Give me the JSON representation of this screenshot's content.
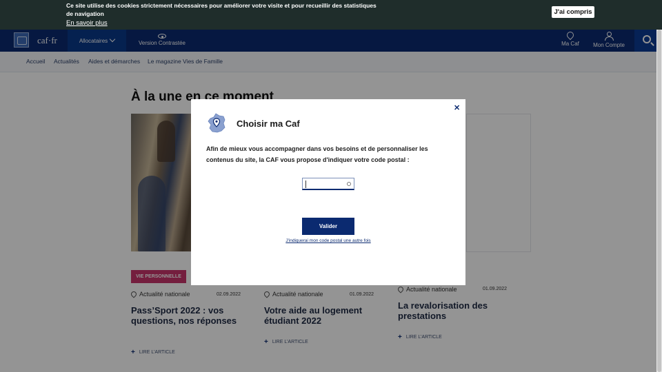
{
  "cookie_banner": {
    "message": "Ce site utilise des cookies strictement nécessaires pour améliorer votre visite et pour recueillir des statistiques de navigation",
    "more_link": "En savoir plus",
    "accept_label": "J'ai compris"
  },
  "header": {
    "logo_text": "caf·fr",
    "allocataires_label": "Allocataires",
    "contrast_label": "Version Contrastée",
    "ma_caf_label": "Ma Caf",
    "mon_compte_label": "Mon Compte"
  },
  "subnav": {
    "items": [
      "Accueil",
      "Actualités",
      "Aides et démarches",
      "Le magazine Vies de Famille"
    ]
  },
  "main": {
    "title": "À la une en ce moment"
  },
  "articles": [
    {
      "badge": "VIE PERSONNELLE",
      "category": "Actualité nationale",
      "date": "02.09.2022",
      "title": "Pass’Sport 2022 : vos questions, nos réponses",
      "link": "LIRE L’ARTICLE"
    },
    {
      "category": "Actualité nationale",
      "date": "01.09.2022",
      "title": "Votre aide au logement étudiant 2022",
      "link": "LIRE L’ARTICLE"
    },
    {
      "category": "Actualité nationale",
      "date": "01.09.2022",
      "title": "La revalorisation des prestations",
      "link": "LIRE L’ARTICLE"
    }
  ],
  "modal": {
    "title": "Choisir ma Caf",
    "body": "Afin de mieux vous accompagner dans vos besoins et de personnaliser les contenus du site, la CAF vous propose d'indiquer votre code postal :",
    "postal_value": "",
    "submit_label": "Valider",
    "later_link": "J'indiquerai mon code postal une autre fois",
    "close_glyph": "✕"
  },
  "colors": {
    "navy": "#0b2a70",
    "badge_pink": "#c9346b",
    "cookie_bg": "#1f2d2b"
  }
}
